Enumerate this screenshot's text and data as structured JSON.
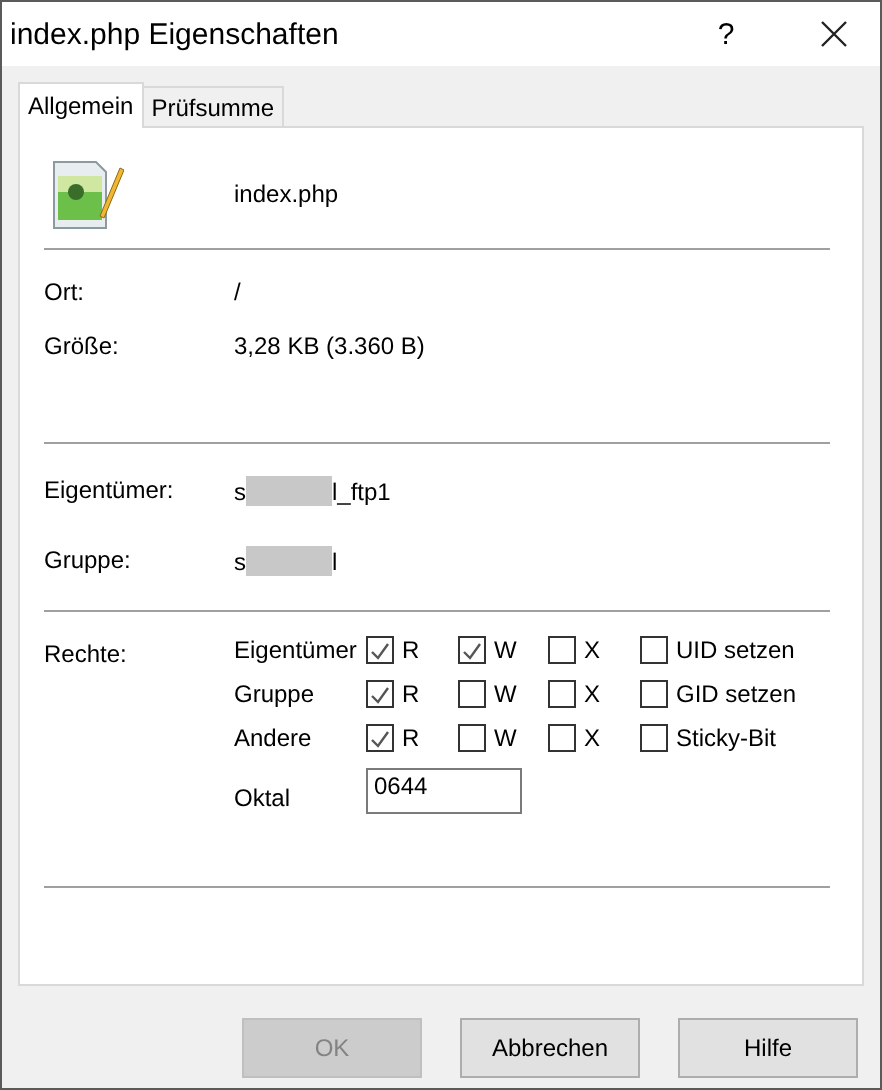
{
  "window": {
    "title": "index.php Eigenschaften",
    "help": "?"
  },
  "tabs": [
    {
      "label": "Allgemein",
      "selected": true
    },
    {
      "label": "Prüfsumme",
      "selected": false
    }
  ],
  "file": {
    "name": "index.php"
  },
  "info": [
    {
      "label": "Ort:",
      "value": "/"
    },
    {
      "label": "Größe:",
      "value": "3,28 KB (3.360 B)"
    }
  ],
  "ownership": [
    {
      "label": "Eigentümer:",
      "before": "s",
      "after": "l_ftp1"
    },
    {
      "label": "Gruppe:",
      "before": "s",
      "after": "l"
    }
  ],
  "permissions": {
    "label": "Rechte:",
    "rows": [
      {
        "label": "Eigentümer",
        "flags": [
          {
            "label": "R",
            "checked": true
          },
          {
            "label": "W",
            "checked": true
          },
          {
            "label": "X",
            "checked": false
          },
          {
            "label": "UID setzen",
            "checked": false
          }
        ]
      },
      {
        "label": "Gruppe",
        "flags": [
          {
            "label": "R",
            "checked": true
          },
          {
            "label": "W",
            "checked": false
          },
          {
            "label": "X",
            "checked": false
          },
          {
            "label": "GID setzen",
            "checked": false
          }
        ]
      },
      {
        "label": "Andere",
        "flags": [
          {
            "label": "R",
            "checked": true
          },
          {
            "label": "W",
            "checked": false
          },
          {
            "label": "X",
            "checked": false
          },
          {
            "label": "Sticky-Bit",
            "checked": false
          }
        ]
      }
    ],
    "octal": {
      "label": "Oktal",
      "value": "0644"
    }
  },
  "buttons": [
    {
      "label": "OK",
      "disabled": true
    },
    {
      "label": "Abbrechen",
      "disabled": false
    },
    {
      "label": "Hilfe",
      "disabled": false
    }
  ]
}
